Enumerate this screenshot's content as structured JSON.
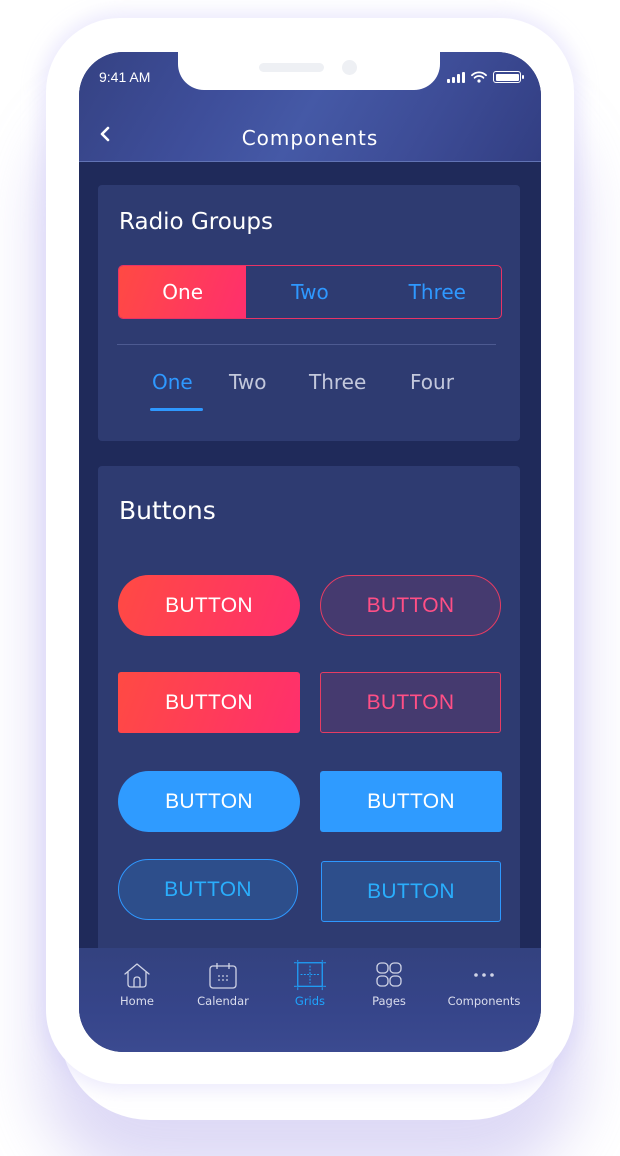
{
  "status_bar": {
    "time": "9:41 AM",
    "icons": [
      "signal-icon",
      "wifi-icon",
      "battery-icon"
    ]
  },
  "header": {
    "back_icon": "chevron-left-icon",
    "title": "Components"
  },
  "radio_groups": {
    "title": "Radio Groups",
    "segmented": {
      "options": [
        "One",
        "Two",
        "Three"
      ],
      "selected": "One"
    },
    "tabs": {
      "options": [
        "One",
        "Two",
        "Three",
        "Four"
      ],
      "selected": "One"
    }
  },
  "buttons_section": {
    "title": "Buttons",
    "buttons": [
      {
        "label": "BUTTON",
        "style": "gradient-pill"
      },
      {
        "label": "BUTTON",
        "style": "gradient-outline-pill"
      },
      {
        "label": "BUTTON",
        "style": "gradient-rect"
      },
      {
        "label": "BUTTON",
        "style": "gradient-outline-rect"
      },
      {
        "label": "BUTTON",
        "style": "blue-pill"
      },
      {
        "label": "BUTTON",
        "style": "blue-rect"
      },
      {
        "label": "BUTTON",
        "style": "blue-outline-pill"
      },
      {
        "label": "BUTTON",
        "style": "blue-outline-rect"
      }
    ]
  },
  "tab_bar": {
    "items": [
      {
        "label": "Home",
        "icon": "home-icon"
      },
      {
        "label": "Calendar",
        "icon": "calendar-icon"
      },
      {
        "label": "Grids",
        "icon": "grid-icon"
      },
      {
        "label": "Pages",
        "icon": "pages-icon"
      },
      {
        "label": "Components",
        "icon": "more-icon"
      }
    ],
    "active": "Grids"
  },
  "colors": {
    "accent_blue": "#2e98ff",
    "gradient_start": "#ff4a43",
    "gradient_end": "#ff2f6d",
    "background": "#1f2a5a",
    "card": "#2e3b71",
    "header": "#3e4e9a"
  }
}
